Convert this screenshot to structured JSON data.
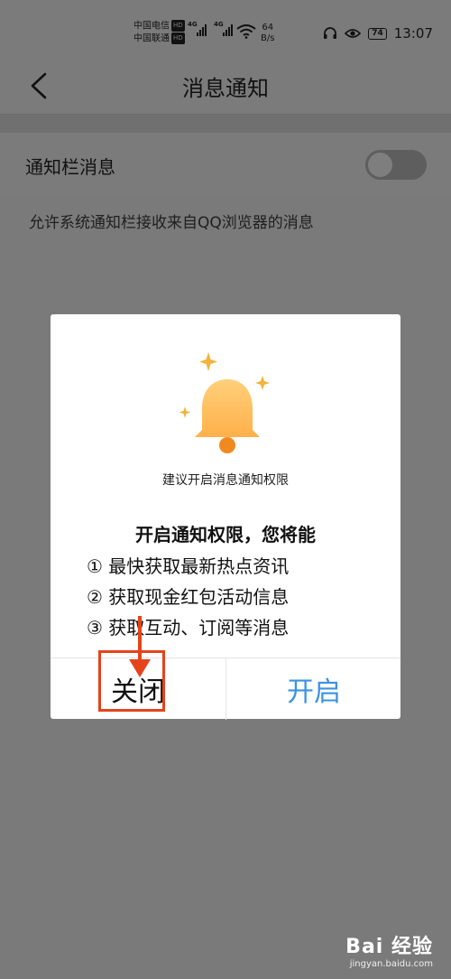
{
  "status_bar": {
    "carrier_1": "中国电信",
    "carrier_2": "中国联通",
    "hd": "HD",
    "net_type": "4G",
    "net_speed_value": "64",
    "net_speed_unit": "B/s",
    "battery": "74",
    "time": "13:07"
  },
  "nav": {
    "title": "消息通知"
  },
  "setting": {
    "label": "通知栏消息",
    "toggle_on": false,
    "description": "允许系统通知栏接收来自QQ浏览器的消息"
  },
  "dialog": {
    "suggest_text": "建议开启消息通知权限",
    "perm_title": "开启通知权限，您将能",
    "items": [
      "① 最快获取最新热点资讯",
      "② 获取现金红包活动信息",
      "③ 获取互动、订阅等消息"
    ],
    "close_label": "关闭",
    "open_label": "开启",
    "accent_color": "#3b93e0",
    "highlight_color": "#e4431c"
  },
  "watermark": {
    "main": "Bai 经验",
    "sub": "jingyan.baidu.com"
  }
}
